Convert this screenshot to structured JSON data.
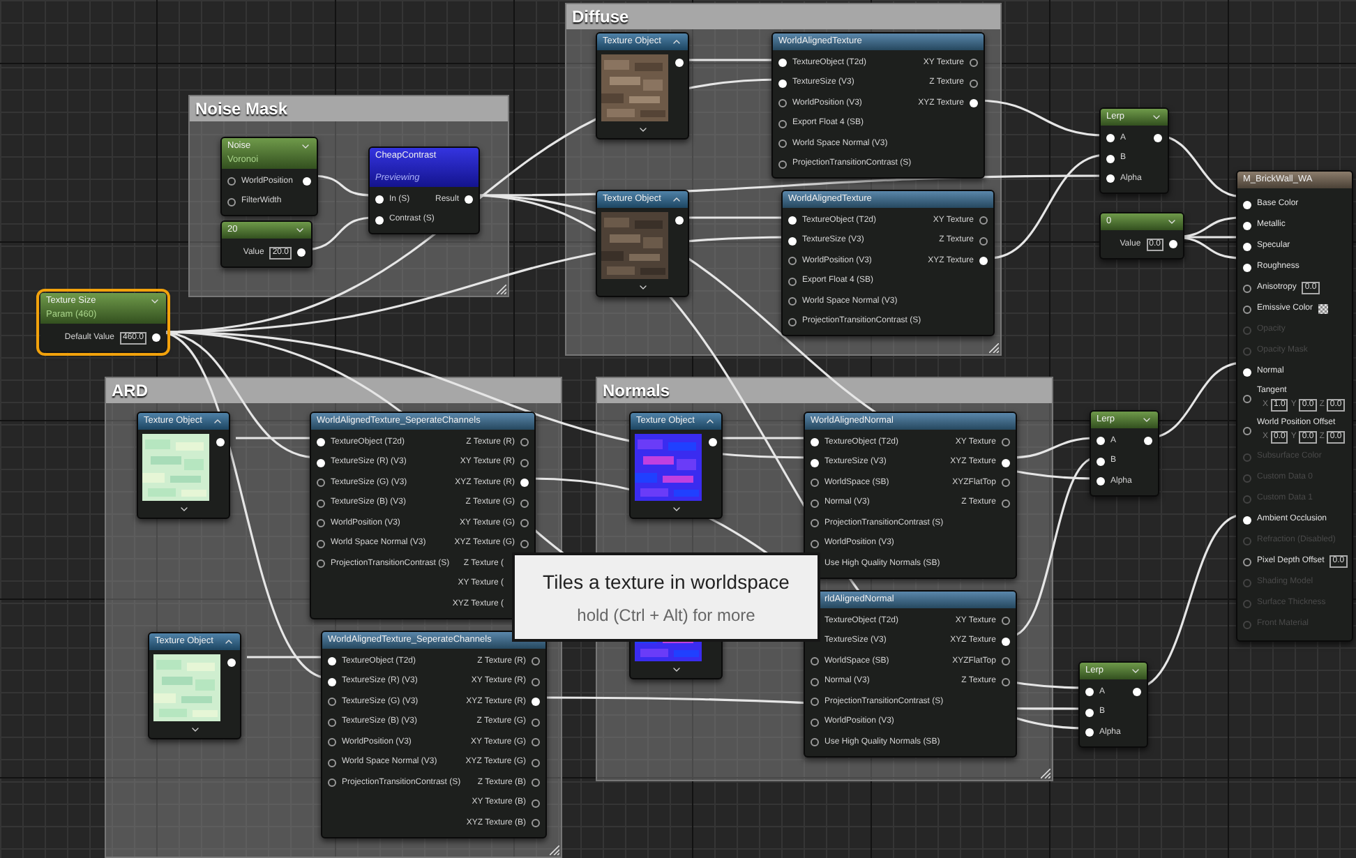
{
  "comments": [
    {
      "title": "Noise Mask"
    },
    {
      "title": "Diffuse"
    },
    {
      "title": "ARD"
    },
    {
      "title": "Normals"
    }
  ],
  "nodes": [
    {
      "kind": "param",
      "title": "Texture Size",
      "subtitle": "Param (460)",
      "selected": true,
      "value_label": "Default Value",
      "value": "460.0",
      "outputs": [
        {
          "connected": true
        }
      ]
    },
    {
      "kind": "expression",
      "title": "Noise",
      "subtitle": "Voronoi",
      "selected": false,
      "inputs": [
        {
          "label": "WorldPosition",
          "connected": false
        },
        {
          "label": "FilterWidth",
          "connected": false
        }
      ],
      "outputs": [
        {
          "connected": true
        }
      ]
    },
    {
      "kind": "constant",
      "title": "20",
      "selected": false,
      "value_label": "Value",
      "value": "20.0",
      "outputs": [
        {
          "connected": true
        }
      ]
    },
    {
      "kind": "preview",
      "title": "CheapContrast",
      "subtitle": "Previewing",
      "selected": false,
      "inputs": [
        {
          "label": "In (S)",
          "connected": true
        },
        {
          "label": "Contrast (S)",
          "connected": true
        }
      ],
      "outputs": [
        {
          "label": "Result",
          "connected": true
        }
      ]
    },
    {
      "kind": "texture",
      "title": "Texture Object",
      "selected": false,
      "outputs": [
        {
          "connected": true
        }
      ]
    },
    {
      "kind": "function",
      "title": "WorldAlignedTexture",
      "selected": false,
      "inputs": [
        {
          "label": "TextureObject (T2d)",
          "connected": true
        },
        {
          "label": "TextureSize (V3)",
          "connected": true
        },
        {
          "label": "WorldPosition (V3)",
          "connected": false
        },
        {
          "label": "Export Float 4 (SB)",
          "connected": false
        },
        {
          "label": "World Space Normal (V3)",
          "connected": false
        },
        {
          "label": "ProjectionTransitionContrast (S)",
          "connected": false
        }
      ],
      "outputs": [
        {
          "label": "XY Texture",
          "connected": false
        },
        {
          "label": "Z Texture",
          "connected": false
        },
        {
          "label": "XYZ Texture",
          "connected": true
        }
      ]
    },
    {
      "kind": "texture",
      "title": "Texture Object",
      "selected": false,
      "outputs": [
        {
          "connected": true
        }
      ]
    },
    {
      "kind": "function",
      "title": "WorldAlignedTexture",
      "selected": false,
      "inputs": [
        {
          "label": "TextureObject (T2d)",
          "connected": true
        },
        {
          "label": "TextureSize (V3)",
          "connected": true
        },
        {
          "label": "WorldPosition (V3)",
          "connected": false
        },
        {
          "label": "Export Float 4 (SB)",
          "connected": false
        },
        {
          "label": "World Space Normal (V3)",
          "connected": false
        },
        {
          "label": "ProjectionTransitionContrast (S)",
          "connected": false
        }
      ],
      "outputs": [
        {
          "label": "XY Texture",
          "connected": false
        },
        {
          "label": "Z Texture",
          "connected": false
        },
        {
          "label": "XYZ Texture",
          "connected": true
        }
      ]
    },
    {
      "kind": "expression",
      "title": "Lerp",
      "selected": false,
      "inputs": [
        {
          "label": "A",
          "connected": true
        },
        {
          "label": "B",
          "connected": true
        },
        {
          "label": "Alpha",
          "connected": true
        }
      ],
      "outputs": [
        {
          "connected": true
        }
      ]
    },
    {
      "kind": "constant",
      "title": "0",
      "selected": false,
      "value_label": "Value",
      "value": "0.0",
      "outputs": [
        {
          "connected": true
        }
      ]
    },
    {
      "kind": "output",
      "title": "M_BrickWall_WA",
      "selected": false,
      "inputs": [
        {
          "kind": "plain",
          "label": "Base Color",
          "connected": true,
          "disabled": false
        },
        {
          "kind": "plain",
          "label": "Metallic",
          "connected": true,
          "disabled": false
        },
        {
          "kind": "plain",
          "label": "Specular",
          "connected": true,
          "disabled": false
        },
        {
          "kind": "plain",
          "label": "Roughness",
          "connected": true,
          "disabled": false
        },
        {
          "kind": "scalar",
          "label": "Anisotropy",
          "connected": false,
          "disabled": false,
          "value": "0.0"
        },
        {
          "kind": "color",
          "label": "Emissive Color",
          "connected": false,
          "disabled": false
        },
        {
          "kind": "plain",
          "label": "Opacity",
          "connected": false,
          "disabled": true
        },
        {
          "kind": "plain",
          "label": "Opacity Mask",
          "connected": false,
          "disabled": true
        },
        {
          "kind": "plain",
          "label": "Normal",
          "connected": true,
          "disabled": false
        },
        {
          "kind": "vector",
          "label": "Tangent",
          "connected": false,
          "disabled": false,
          "vector": [
            {
              "axis": "X",
              "value": "1.0"
            },
            {
              "axis": "Y",
              "value": "0.0"
            },
            {
              "axis": "Z",
              "value": "0.0"
            }
          ]
        },
        {
          "kind": "vector",
          "label": "World Position Offset",
          "connected": false,
          "disabled": false,
          "vector": [
            {
              "axis": "X",
              "value": "0.0"
            },
            {
              "axis": "Y",
              "value": "0.0"
            },
            {
              "axis": "Z",
              "value": "0.0"
            }
          ]
        },
        {
          "kind": "plain",
          "label": "Subsurface Color",
          "connected": false,
          "disabled": true
        },
        {
          "kind": "plain",
          "label": "Custom Data 0",
          "connected": false,
          "disabled": true
        },
        {
          "kind": "plain",
          "label": "Custom Data 1",
          "connected": false,
          "disabled": true
        },
        {
          "kind": "plain",
          "label": "Ambient Occlusion",
          "connected": true,
          "disabled": false
        },
        {
          "kind": "plain",
          "label": "Refraction (Disabled)",
          "connected": false,
          "disabled": true
        },
        {
          "kind": "scalar",
          "label": "Pixel Depth Offset",
          "connected": false,
          "disabled": false,
          "value": "0.0"
        },
        {
          "kind": "plain",
          "label": "Shading Model",
          "connected": false,
          "disabled": true
        },
        {
          "kind": "plain",
          "label": "Surface Thickness",
          "connected": false,
          "disabled": true
        },
        {
          "kind": "plain",
          "label": "Front Material",
          "connected": false,
          "disabled": true
        }
      ]
    },
    {
      "kind": "texture",
      "title": "Texture Object",
      "selected": false,
      "outputs": [
        {
          "connected": true
        }
      ]
    },
    {
      "kind": "function",
      "title": "WorldAlignedTexture_SeperateChannels",
      "selected": false,
      "inputs": [
        {
          "label": "TextureObject (T2d)",
          "connected": true
        },
        {
          "label": "TextureSize (R) (V3)",
          "connected": true
        },
        {
          "label": "TextureSize (G) (V3)",
          "connected": false
        },
        {
          "label": "TextureSize (B) (V3)",
          "connected": false
        },
        {
          "label": "WorldPosition (V3)",
          "connected": false
        },
        {
          "label": "World Space Normal (V3)",
          "connected": false
        },
        {
          "label": "ProjectionTransitionContrast (S)",
          "connected": false
        }
      ],
      "outputs": [
        {
          "label": "Z Texture (R)",
          "connected": false
        },
        {
          "label": "XY Texture (R)",
          "connected": false
        },
        {
          "label": "XYZ Texture (R)",
          "connected": true
        },
        {
          "label": "Z Texture (G)",
          "connected": false
        },
        {
          "label": "XY Texture (G)",
          "connected": false
        },
        {
          "label": "XYZ Texture (G)",
          "connected": false
        },
        {
          "label": "Z Texture ("
        },
        {
          "label": "XY Texture ("
        },
        {
          "label": "XYZ Texture ("
        }
      ]
    },
    {
      "kind": "texture",
      "title": "Texture Object",
      "selected": false,
      "outputs": [
        {
          "connected": true
        }
      ]
    },
    {
      "kind": "function",
      "title": "WorldAlignedTexture_SeperateChannels",
      "selected": false,
      "inputs": [
        {
          "label": "TextureObject (T2d)",
          "connected": true
        },
        {
          "label": "TextureSize (R) (V3)",
          "connected": true
        },
        {
          "label": "TextureSize (G) (V3)",
          "connected": false
        },
        {
          "label": "TextureSize (B) (V3)",
          "connected": false
        },
        {
          "label": "WorldPosition (V3)",
          "connected": false
        },
        {
          "label": "World Space Normal (V3)",
          "connected": false
        },
        {
          "label": "ProjectionTransitionContrast (S)",
          "connected": false
        }
      ],
      "outputs": [
        {
          "label": "Z Texture (R)",
          "connected": false
        },
        {
          "label": "XY Texture (R)",
          "connected": false
        },
        {
          "label": "XYZ Texture (R)",
          "connected": true
        },
        {
          "label": "Z Texture (G)",
          "connected": false
        },
        {
          "label": "XY Texture (G)",
          "connected": false
        },
        {
          "label": "XYZ Texture (G)",
          "connected": false
        },
        {
          "label": "Z Texture (B)",
          "connected": false
        },
        {
          "label": "XY Texture (B)",
          "connected": false
        },
        {
          "label": "XYZ Texture (B)",
          "connected": false
        }
      ]
    },
    {
      "kind": "texture",
      "title": "Texture Object",
      "selected": false,
      "outputs": [
        {
          "connected": true
        }
      ]
    },
    {
      "kind": "function",
      "title": "WorldAlignedNormal",
      "selected": false,
      "inputs": [
        {
          "label": "TextureObject (T2d)",
          "connected": true
        },
        {
          "label": "TextureSize (V3)",
          "connected": true
        },
        {
          "label": "WorldSpace (SB)",
          "connected": false
        },
        {
          "label": "Normal (V3)",
          "connected": false
        },
        {
          "label": "ProjectionTransitionContrast (S)",
          "connected": false
        },
        {
          "label": "WorldPosition (V3)",
          "connected": false
        },
        {
          "label": "Use High Quality Normals (SB)"
        }
      ],
      "outputs": [
        {
          "label": "XY Texture",
          "connected": false
        },
        {
          "label": "XYZ Texture",
          "connected": true
        },
        {
          "label": "XYZFlatTop",
          "connected": false
        },
        {
          "label": "Z Texture",
          "connected": false
        }
      ]
    },
    {
      "kind": "texture",
      "selected": false
    },
    {
      "kind": "function",
      "title": "rldAlignedNormal",
      "selected": false,
      "inputs": [
        {
          "label": "TextureObject (T2d)"
        },
        {
          "label": "TextureSize (V3)"
        },
        {
          "label": "WorldSpace (SB)",
          "connected": false
        },
        {
          "label": "Normal (V3)",
          "connected": false
        },
        {
          "label": "ProjectionTransitionContrast (S)",
          "connected": false
        },
        {
          "label": "WorldPosition (V3)",
          "connected": false
        },
        {
          "label": "Use High Quality Normals (SB)",
          "connected": false
        }
      ],
      "outputs": [
        {
          "label": "XY Texture",
          "connected": false
        },
        {
          "label": "XYZ Texture",
          "connected": true
        },
        {
          "label": "XYZFlatTop",
          "connected": false
        },
        {
          "label": "Z Texture",
          "connected": false
        }
      ]
    },
    {
      "kind": "expression",
      "title": "Lerp",
      "selected": false,
      "inputs": [
        {
          "label": "A",
          "connected": true
        },
        {
          "label": "B",
          "connected": true
        },
        {
          "label": "Alpha",
          "connected": true
        }
      ],
      "outputs": [
        {
          "connected": true
        }
      ]
    },
    {
      "kind": "expression",
      "title": "Lerp",
      "selected": false,
      "inputs": [
        {
          "label": "A",
          "connected": true
        },
        {
          "label": "B",
          "connected": true
        },
        {
          "label": "Alpha",
          "connected": true
        }
      ],
      "outputs": [
        {
          "connected": true
        }
      ]
    }
  ],
  "tooltip": {
    "title": "Tiles a texture in worldspace",
    "hint": "hold (Ctrl + Alt) for more"
  }
}
